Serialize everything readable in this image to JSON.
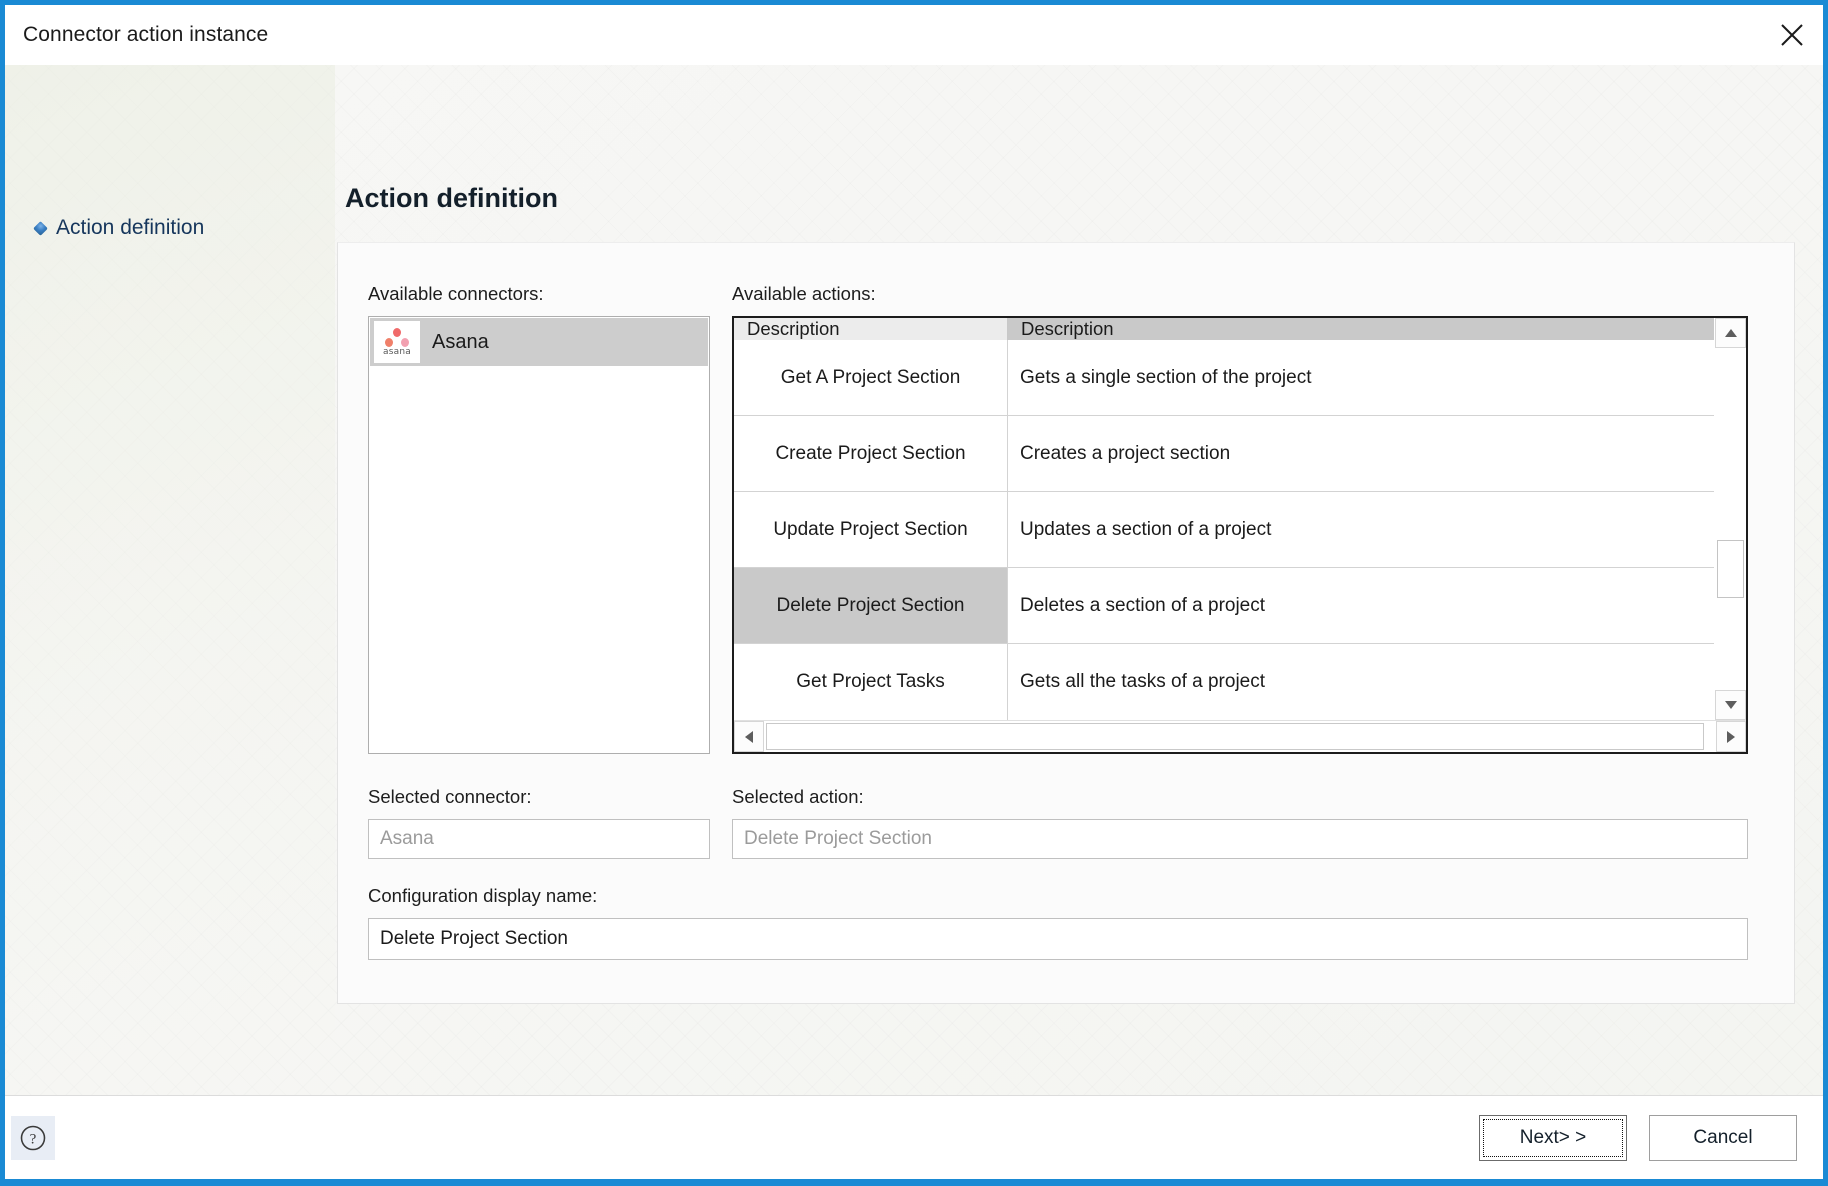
{
  "window": {
    "title": "Connector action instance",
    "close_icon": "close-icon"
  },
  "sidebar": {
    "items": [
      {
        "label": "Action definition",
        "bullet_icon": "blue-diamond-bullet-icon"
      }
    ]
  },
  "main": {
    "page_title": "Action definition",
    "connectors": {
      "label": "Available connectors:",
      "items": [
        {
          "name": "Asana",
          "logo_icon": "asana-logo-icon",
          "logo_word": "asana",
          "selected": true
        }
      ]
    },
    "actions": {
      "label": "Available actions:",
      "columns": [
        "Description",
        "Description"
      ],
      "rows": [
        {
          "name": "Get A Project Section",
          "description": "Gets a single section of the project",
          "selected": false
        },
        {
          "name": "Create Project Section",
          "description": "Creates a project section",
          "selected": false
        },
        {
          "name": "Update Project Section",
          "description": "Updates a section of a project",
          "selected": false
        },
        {
          "name": "Delete Project Section",
          "description": "Deletes a section of a project",
          "selected": true
        },
        {
          "name": "Get Project Tasks",
          "description": "Gets all the tasks of a project",
          "selected": false
        }
      ],
      "scroll_up_icon": "triangle-up-icon",
      "scroll_down_icon": "triangle-down-icon",
      "scroll_left_icon": "triangle-left-icon",
      "scroll_right_icon": "triangle-right-icon"
    },
    "selected_connector": {
      "label": "Selected connector:",
      "value": "Asana"
    },
    "selected_action": {
      "label": "Selected action:",
      "value": "Delete Project Section"
    },
    "configuration_display_name": {
      "label": "Configuration display name:",
      "value": "Delete Project Section"
    }
  },
  "footer": {
    "help_icon": "help-question-icon",
    "next_label": "Next> >",
    "cancel_label": "Cancel"
  },
  "colors": {
    "accent": "#1a8ad4",
    "nav_text": "#16365c",
    "selection": "#c9c9c9"
  }
}
